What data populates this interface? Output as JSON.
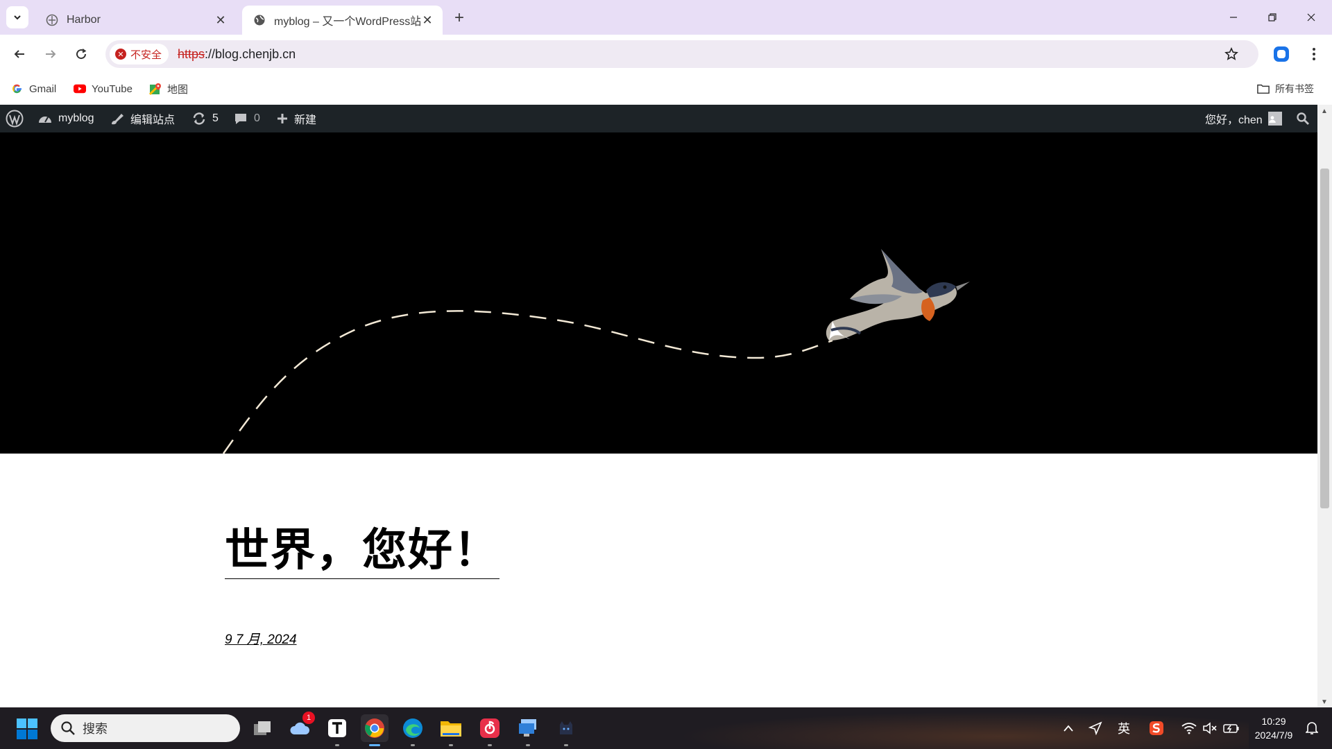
{
  "browser": {
    "tabs": [
      {
        "title": "Harbor",
        "active": false
      },
      {
        "title": "myblog – 又一个WordPress站",
        "active": true
      }
    ],
    "address": {
      "security_label": "不安全",
      "url_protocol": "https",
      "url_rest": "://blog.chenjb.cn"
    },
    "bookmarks": [
      {
        "label": "Gmail",
        "icon": "google-icon"
      },
      {
        "label": "YouTube",
        "icon": "youtube-icon"
      },
      {
        "label": "地图",
        "icon": "maps-icon"
      }
    ],
    "all_bookmarks_label": "所有书签"
  },
  "admin_bar": {
    "site_name": "myblog",
    "edit_site": "编辑站点",
    "updates_count": "5",
    "comments_count": "0",
    "new_label": "新建",
    "greeting": "您好，chen"
  },
  "post": {
    "title": "世界，您好！",
    "date": "9 7 月, 2024"
  },
  "taskbar": {
    "search_placeholder": "搜索",
    "weather_badge": "1",
    "ime_label": "英",
    "time": "10:29",
    "date": "2024/7/9"
  },
  "colors": {
    "tabstrip": "#e8def6",
    "admin_bar": "#1d2327",
    "hero_bg": "#000000",
    "insecure_red": "#c5221f"
  }
}
